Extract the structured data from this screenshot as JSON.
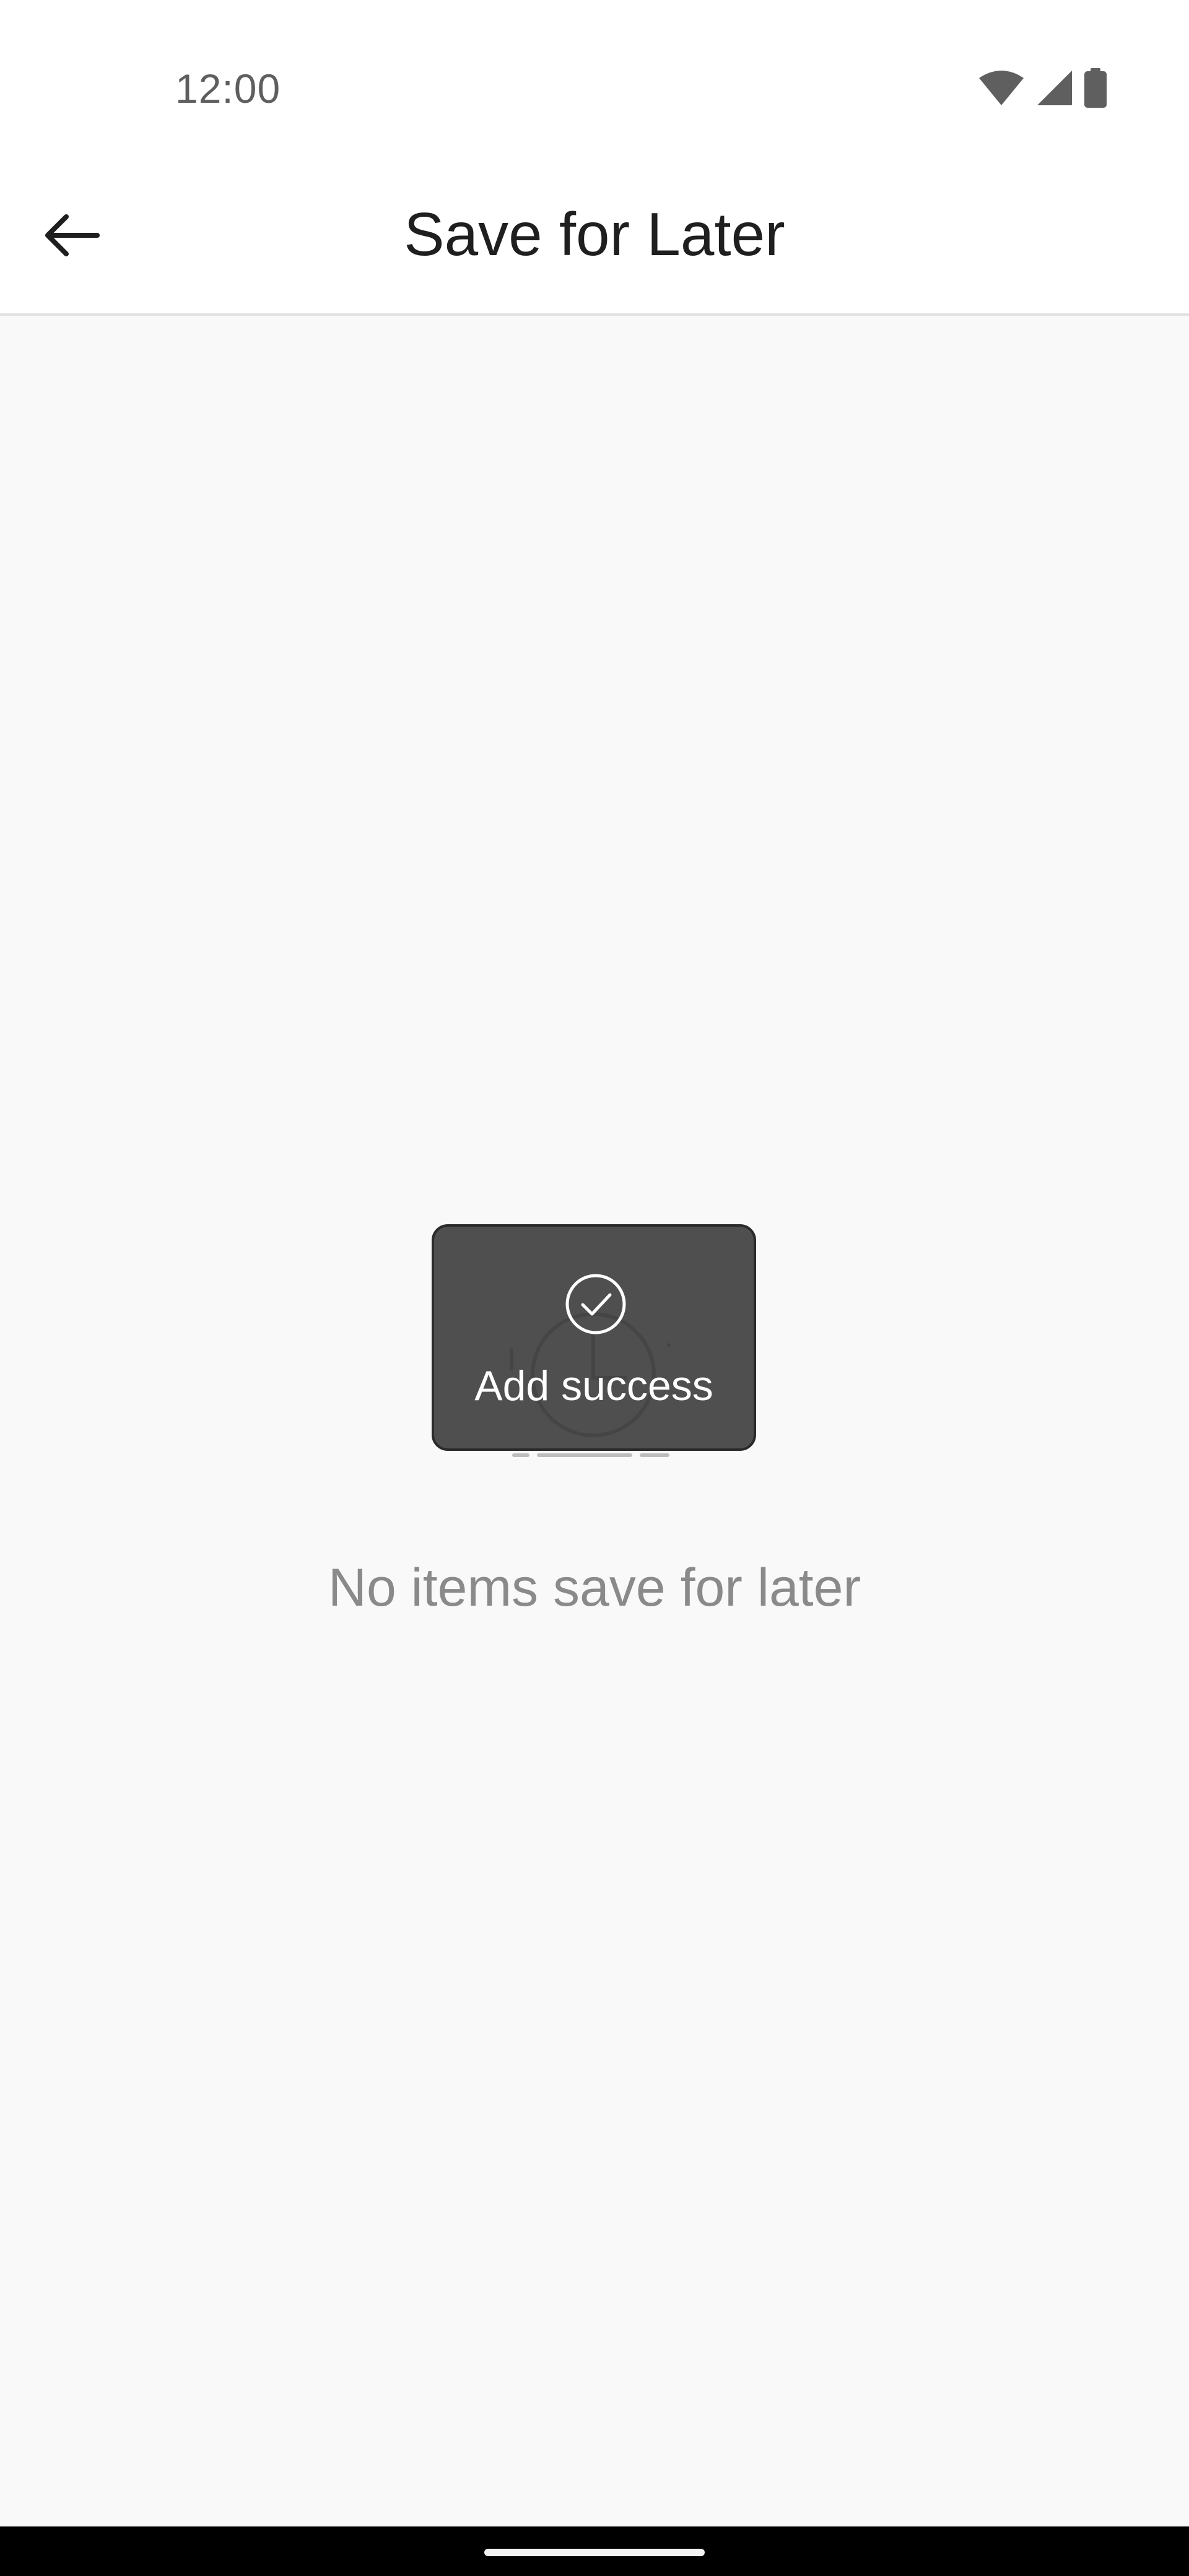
{
  "status_bar": {
    "time": "12:00",
    "icons": [
      "wifi-icon",
      "cellular-signal-icon",
      "battery-icon"
    ]
  },
  "app_bar": {
    "back_icon": "arrow-left-icon",
    "title": "Save for Later"
  },
  "empty_state": {
    "illustration_icon": "empty-save-for-later-illustration",
    "message": "No items save for later"
  },
  "toast": {
    "icon": "check-circle-icon",
    "message": "Add success"
  },
  "colors": {
    "background": "#f9f9f9",
    "app_bar": "#ffffff",
    "toast_bg": "#3c3c3c",
    "empty_text": "#8a8a8a",
    "title_text": "#1f1f1f"
  }
}
